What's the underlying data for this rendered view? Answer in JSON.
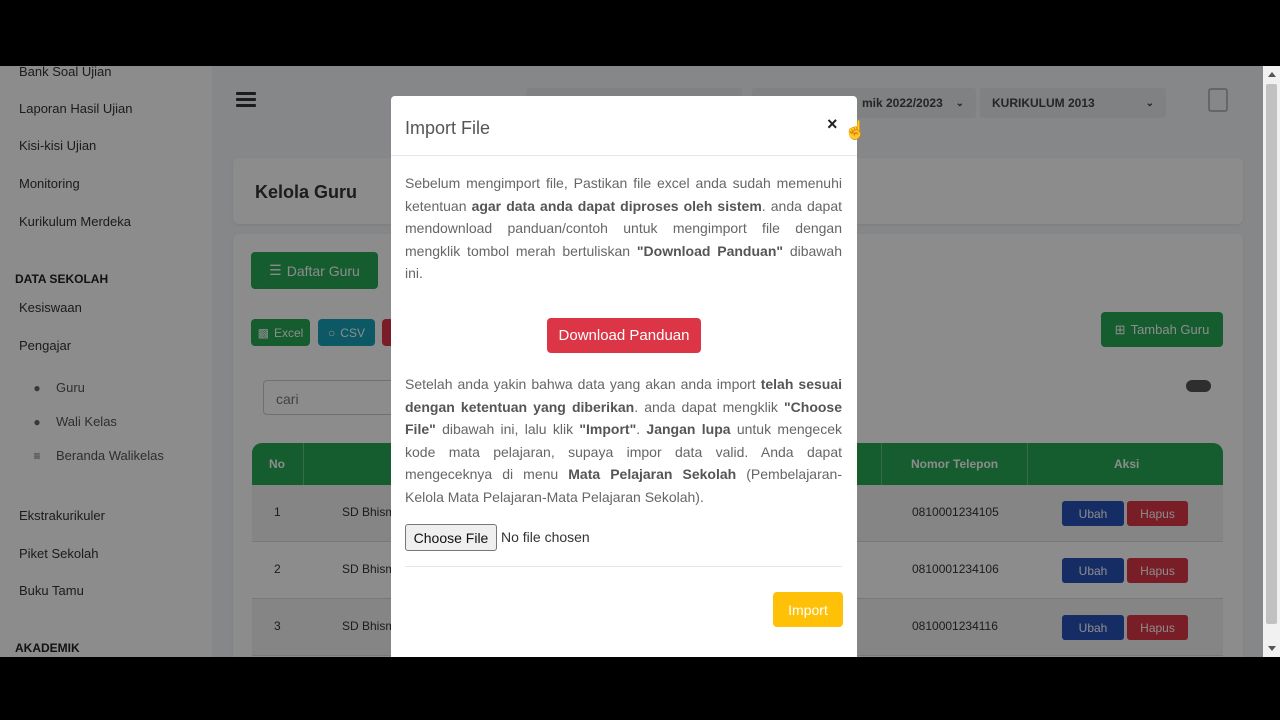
{
  "sidebar": {
    "items_top": [
      "Bank Soal Ujian",
      "Laporan Hasil Ujian",
      "Kisi-kisi Ujian",
      "Monitoring",
      "Kurikulum Merdeka"
    ],
    "section_sekolah": "DATA SEKOLAH",
    "items_sekolah": [
      "Kesiswaan",
      "Pengajar"
    ],
    "sub_items": [
      "Guru",
      "Wali Kelas",
      "Beranda Walikelas"
    ],
    "items_bottom": [
      "Ekstrakurikuler",
      "Piket Sekolah",
      "Buku Tamu"
    ],
    "section_akademik": "AKADEMIK"
  },
  "header": {
    "year_select": "mik 2022/2023",
    "curriculum_select": "KURIKULUM 2013"
  },
  "page": {
    "title": "Kelola Guru",
    "daftar_button": "Daftar Guru",
    "excel_button": "Excel",
    "csv_button": "CSV",
    "tambah_button": "Tambah Guru",
    "search_placeholder": "cari"
  },
  "table": {
    "headers": {
      "no": "No",
      "phone": "Nomor Telepon",
      "action": "Aksi"
    },
    "rows": [
      {
        "no": "1",
        "school": "SD Bhism",
        "phone": "0810001234105"
      },
      {
        "no": "2",
        "school": "SD Bhism",
        "phone": "0810001234106"
      },
      {
        "no": "3",
        "school": "SD Bhism",
        "phone": "0810001234116"
      }
    ],
    "edit_label": "Ubah",
    "delete_label": "Hapus"
  },
  "modal": {
    "title": "Import File",
    "close": "×",
    "download_button": "Download Panduan",
    "choose_file_button": "Choose File",
    "file_status": "No file chosen",
    "import_button": "Import",
    "p1": {
      "t1": "Sebelum mengimport file, Pastikan file excel anda sudah memenuhi ketentuan ",
      "b1": "agar data anda dapat diproses oleh sistem",
      "t2": ". anda dapat mendownload panduan/contoh untuk mengimport file dengan mengklik tombol merah bertuliskan ",
      "b2": "\"Download Panduan\"",
      "t3": " dibawah ini."
    },
    "p2": {
      "t1": "Setelah anda yakin bahwa data yang akan anda import ",
      "b1": "telah sesuai dengan ketentuan yang diberikan",
      "t2": ". anda dapat mengklik ",
      "b2": "\"Choose File\"",
      "t3": " dibawah ini, lalu klik ",
      "b3": "\"Import\"",
      "t4": ". ",
      "b4": "Jangan lupa",
      "t5": " untuk mengecek kode mata pelajaran, supaya impor data valid. Anda dapat mengeceknya di menu ",
      "b5": "Mata Pelajaran Sekolah",
      "t6": " (Pembelajaran-Kelola Mata Pelajaran-Mata Pelajaran Sekolah)."
    }
  },
  "colors": {
    "green": "#27a857",
    "teal": "#17a2b8",
    "red": "#dc3545",
    "blue": "#2850b8",
    "yellow": "#ffc107"
  }
}
